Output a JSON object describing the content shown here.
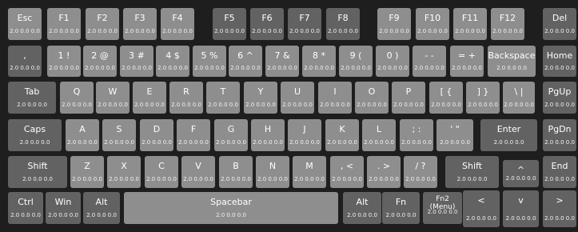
{
  "keyboard": {
    "rows": [
      [
        {
          "name": "esc",
          "label": "Esc",
          "stats": "2.0  0.0  0.0",
          "tone": "light"
        },
        {
          "name": "f1",
          "label": "F1",
          "stats": "2.0  0.0  0.0",
          "tone": "light"
        },
        {
          "name": "f2",
          "label": "F2",
          "stats": "2.0  0.0  0.0",
          "tone": "light"
        },
        {
          "name": "f3",
          "label": "F3",
          "stats": "2.0  0.0  0.0",
          "tone": "light"
        },
        {
          "name": "f4",
          "label": "F4",
          "stats": "2.0  0.0  0.0",
          "tone": "light"
        },
        {
          "name": "f5",
          "label": "F5",
          "stats": "2.0  0.0  0.0",
          "tone": "dark"
        },
        {
          "name": "f6",
          "label": "F6",
          "stats": "2.0  0.0  0.0",
          "tone": "dark"
        },
        {
          "name": "f7",
          "label": "F7",
          "stats": "2.0  0.0  0.0",
          "tone": "dark"
        },
        {
          "name": "f8",
          "label": "F8",
          "stats": "2.0  0.0  0.0",
          "tone": "dark"
        },
        {
          "name": "f9",
          "label": "F9",
          "stats": "2.0  0.0  0.0",
          "tone": "light"
        },
        {
          "name": "f10",
          "label": "F10",
          "stats": "2.0  0.0  0.0",
          "tone": "light"
        },
        {
          "name": "f11",
          "label": "F11",
          "stats": "2.0  0.0  0.0",
          "tone": "light"
        },
        {
          "name": "f12",
          "label": "F12",
          "stats": "2.0  0.0  0.0",
          "tone": "light"
        },
        {
          "name": "del",
          "label": "Del",
          "stats": "2.0  0.0  0.0",
          "tone": "dark"
        }
      ],
      [
        {
          "name": "backtick",
          "label": ",",
          "stats": "2.0  0.0  0.0",
          "tone": "dark"
        },
        {
          "name": "1",
          "label": "1  !",
          "stats": "2.0  0.0  0.0",
          "tone": "light"
        },
        {
          "name": "2",
          "label": "2  @",
          "stats": "2.0  0.0  0.0",
          "tone": "light"
        },
        {
          "name": "3",
          "label": "3  #",
          "stats": "2.0  0.0  0.0",
          "tone": "light"
        },
        {
          "name": "4",
          "label": "4  $",
          "stats": "2.0  0.0  0.0",
          "tone": "light"
        },
        {
          "name": "5",
          "label": "5  %",
          "stats": "2.0  0.0  0.0",
          "tone": "light"
        },
        {
          "name": "6",
          "label": "6  ^",
          "stats": "2.0  0.0  0.0",
          "tone": "light"
        },
        {
          "name": "7",
          "label": "7  &",
          "stats": "2.0  0.0  0.0",
          "tone": "light"
        },
        {
          "name": "8",
          "label": "8  *",
          "stats": "2.0  0.0  0.0",
          "tone": "light"
        },
        {
          "name": "9",
          "label": "9  (",
          "stats": "2.0  0.0  0.0",
          "tone": "light"
        },
        {
          "name": "0",
          "label": "0  )",
          "stats": "2.0  0.0  0.0",
          "tone": "light"
        },
        {
          "name": "minus",
          "label": "-  -",
          "stats": "2.0  0.0  0.0",
          "tone": "light"
        },
        {
          "name": "equals",
          "label": "=  +",
          "stats": "2.0  0.0  0.0",
          "tone": "light"
        },
        {
          "name": "backspace",
          "label": "Backspace",
          "stats": "2.0  0.0  0.0",
          "tone": "light"
        },
        {
          "name": "home",
          "label": "Home",
          "stats": "2.0  0.0  0.0",
          "tone": "dark"
        }
      ],
      [
        {
          "name": "tab",
          "label": "Tab",
          "stats": "2.0  0.0  0.0",
          "tone": "dark"
        },
        {
          "name": "q",
          "label": "Q",
          "stats": "2.0  0.0  0.0",
          "tone": "light"
        },
        {
          "name": "w",
          "label": "W",
          "stats": "2.0  0.0  0.0",
          "tone": "light"
        },
        {
          "name": "e",
          "label": "E",
          "stats": "2.0  0.0  0.0",
          "tone": "light"
        },
        {
          "name": "r",
          "label": "R",
          "stats": "2.0  0.0  0.0",
          "tone": "light"
        },
        {
          "name": "t",
          "label": "T",
          "stats": "2.0  0.0  0.0",
          "tone": "light"
        },
        {
          "name": "y",
          "label": "Y",
          "stats": "2.0  0.0  0.0",
          "tone": "light"
        },
        {
          "name": "u",
          "label": "U",
          "stats": "2.0  0.0  0.0",
          "tone": "light"
        },
        {
          "name": "i",
          "label": "I",
          "stats": "2.0  0.0  0.0",
          "tone": "light"
        },
        {
          "name": "o",
          "label": "O",
          "stats": "2.0  0.0  0.0",
          "tone": "light"
        },
        {
          "name": "p",
          "label": "P",
          "stats": "2.0  0.0  0.0",
          "tone": "light"
        },
        {
          "name": "lbracket",
          "label": "[  {",
          "stats": "2.0  0.0  0.0",
          "tone": "light"
        },
        {
          "name": "rbracket",
          "label": "]  }",
          "stats": "2.0  0.0  0.0",
          "tone": "light"
        },
        {
          "name": "backslash",
          "label": "\\  |",
          "stats": "2.0  0.0  0.0",
          "tone": "light"
        },
        {
          "name": "pgup",
          "label": "PgUp",
          "stats": "2.0  0.0  0.0",
          "tone": "dark"
        }
      ],
      [
        {
          "name": "caps",
          "label": "Caps",
          "stats": "2.0  0.0  0.0",
          "tone": "dark"
        },
        {
          "name": "a",
          "label": "A",
          "stats": "2.0  0.0  0.0",
          "tone": "light"
        },
        {
          "name": "s",
          "label": "S",
          "stats": "2.0  0.0  0.0",
          "tone": "light"
        },
        {
          "name": "d",
          "label": "D",
          "stats": "2.0  0.0  0.0",
          "tone": "light"
        },
        {
          "name": "f",
          "label": "F",
          "stats": "2.0  0.0  0.0",
          "tone": "light"
        },
        {
          "name": "g",
          "label": "G",
          "stats": "2.0  0.0  0.0",
          "tone": "light"
        },
        {
          "name": "h",
          "label": "H",
          "stats": "2.0  0.0  0.0",
          "tone": "light"
        },
        {
          "name": "j",
          "label": "J",
          "stats": "2.0  0.0  0.0",
          "tone": "light"
        },
        {
          "name": "k",
          "label": "K",
          "stats": "2.0  0.0  0.0",
          "tone": "light"
        },
        {
          "name": "l",
          "label": "L",
          "stats": "2.0  0.0  0.0",
          "tone": "light"
        },
        {
          "name": "semicolon",
          "label": ";  :",
          "stats": "2.0  0.0  0.0",
          "tone": "light"
        },
        {
          "name": "quote",
          "label": "'  \"",
          "stats": "2.0  0.0  0.0",
          "tone": "light"
        },
        {
          "name": "enter",
          "label": "Enter",
          "stats": "2.0  0.0  0.0",
          "tone": "dark"
        },
        {
          "name": "pgdn",
          "label": "PgDn",
          "stats": "2.0  0.0  0.0",
          "tone": "dark"
        }
      ],
      [
        {
          "name": "lshift",
          "label": "Shift",
          "stats": "2.0  0.0  0.0",
          "tone": "dark"
        },
        {
          "name": "z",
          "label": "Z",
          "stats": "2.0  0.0  0.0",
          "tone": "light"
        },
        {
          "name": "x",
          "label": "X",
          "stats": "2.0  0.0  0.0",
          "tone": "light"
        },
        {
          "name": "c",
          "label": "C",
          "stats": "2.0  0.0  0.0",
          "tone": "light"
        },
        {
          "name": "v",
          "label": "V",
          "stats": "2.0  0.0  0.0",
          "tone": "light"
        },
        {
          "name": "b",
          "label": "B",
          "stats": "2.0  0.0  0.0",
          "tone": "light"
        },
        {
          "name": "n",
          "label": "N",
          "stats": "2.0  0.0  0.0",
          "tone": "light"
        },
        {
          "name": "m",
          "label": "M",
          "stats": "2.0  0.0  0.0",
          "tone": "light"
        },
        {
          "name": "comma",
          "label": ",  <",
          "stats": "2.0  0.0  0.0",
          "tone": "light"
        },
        {
          "name": "period",
          "label": ".  >",
          "stats": "2.0  0.0  0.0",
          "tone": "light"
        },
        {
          "name": "slash",
          "label": "/  ?",
          "stats": "2.0  0.0  0.0",
          "tone": "light"
        },
        {
          "name": "rshift",
          "label": "Shift",
          "stats": "2.0  0.0  0.0",
          "tone": "dark"
        },
        {
          "name": "up",
          "label": "^",
          "stats": "2.0  0.0  0.0",
          "tone": "dark"
        },
        {
          "name": "end",
          "label": "End",
          "stats": "2.0  0.0  0.0",
          "tone": "dark"
        }
      ],
      [
        {
          "name": "lctrl",
          "label": "Ctrl",
          "stats": "2.0  0.0  0.0",
          "tone": "dark"
        },
        {
          "name": "win",
          "label": "Win",
          "stats": "2.0  0.0  0.0",
          "tone": "dark"
        },
        {
          "name": "lalt",
          "label": "Alt",
          "stats": "2.0  0.0  0.0",
          "tone": "dark"
        },
        {
          "name": "spacebar",
          "label": "Spacebar",
          "stats": "2.0  0.0  0.0",
          "tone": "light"
        },
        {
          "name": "ralt",
          "label": "Alt",
          "stats": "2.0  0.0  0.0",
          "tone": "dark"
        },
        {
          "name": "fn",
          "label": "Fn",
          "stats": "2.0  0.0  0.0",
          "tone": "dark"
        },
        {
          "name": "fn2",
          "label": "Fn2\n(Menu)",
          "stats": "2.0  0.0  0.0",
          "tone": "dark"
        },
        {
          "name": "left",
          "label": "<",
          "stats": "2.0  0.0  0.0",
          "tone": "dark"
        },
        {
          "name": "down",
          "label": "v",
          "stats": "2.0  0.0  0.0",
          "tone": "dark"
        },
        {
          "name": "right",
          "label": ">",
          "stats": "2.0  0.0  0.0",
          "tone": "dark"
        }
      ]
    ]
  }
}
